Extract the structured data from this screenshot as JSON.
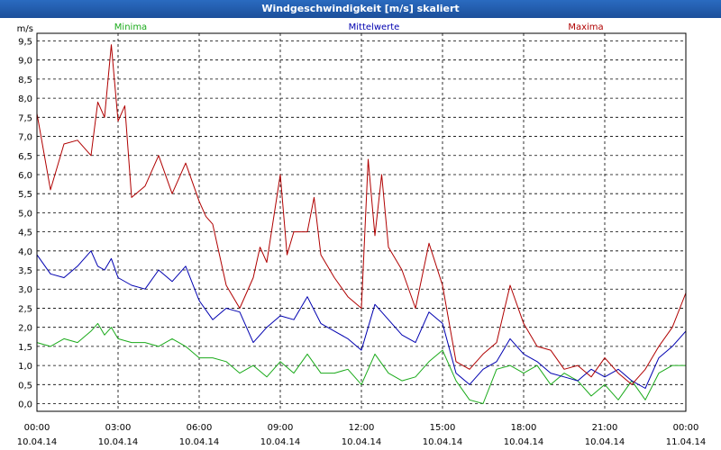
{
  "window": {
    "title": "Windgeschwindigkeit [m/s] skaliert"
  },
  "chart_data": {
    "type": "line",
    "title": "Windgeschwindigkeit [m/s] skaliert",
    "ylabel": "m/s",
    "ylim": [
      -0.2,
      9.7
    ],
    "yticks": [
      "9,5",
      "9,0",
      "8,5",
      "8,0",
      "7,5",
      "7,0",
      "6,5",
      "6,0",
      "5,5",
      "5,0",
      "4,5",
      "4,0",
      "3,5",
      "3,0",
      "2,5",
      "2,0",
      "1,5",
      "1,0",
      "0,5",
      "0,0"
    ],
    "ytick_values": [
      9.5,
      9.0,
      8.5,
      8.0,
      7.5,
      7.0,
      6.5,
      6.0,
      5.5,
      5.0,
      4.5,
      4.0,
      3.5,
      3.0,
      2.5,
      2.0,
      1.5,
      1.0,
      0.5,
      0.0
    ],
    "xlim": [
      0,
      24
    ],
    "xticks": [
      {
        "x": 0,
        "time": "00:00",
        "date": "10.04.14"
      },
      {
        "x": 3,
        "time": "03:00",
        "date": "10.04.14"
      },
      {
        "x": 6,
        "time": "06:00",
        "date": "10.04.14"
      },
      {
        "x": 9,
        "time": "09:00",
        "date": "10.04.14"
      },
      {
        "x": 12,
        "time": "12:00",
        "date": "10.04.14"
      },
      {
        "x": 15,
        "time": "15:00",
        "date": "10.04.14"
      },
      {
        "x": 18,
        "time": "18:00",
        "date": "10.04.14"
      },
      {
        "x": 21,
        "time": "21:00",
        "date": "10.04.14"
      },
      {
        "x": 24,
        "time": "00:00",
        "date": "11.04.14"
      }
    ],
    "grid": true,
    "legend_position": "top",
    "series": [
      {
        "name": "Minima",
        "color": "#1aaa1a",
        "x": [
          0,
          0.5,
          1,
          1.5,
          2,
          2.25,
          2.5,
          2.75,
          3,
          3.5,
          4,
          4.5,
          5,
          5.5,
          6,
          6.5,
          7,
          7.5,
          8,
          8.5,
          9,
          9.5,
          10,
          10.5,
          11,
          11.5,
          12,
          12.5,
          13,
          13.5,
          14,
          14.5,
          15,
          15.5,
          16,
          16.5,
          17,
          17.5,
          18,
          18.5,
          19,
          19.5,
          20,
          20.5,
          21,
          21.5,
          22,
          22.5,
          23,
          23.5,
          24
        ],
        "values": [
          1.6,
          1.5,
          1.7,
          1.6,
          1.9,
          2.1,
          1.8,
          2.0,
          1.7,
          1.6,
          1.6,
          1.5,
          1.7,
          1.5,
          1.2,
          1.2,
          1.1,
          0.8,
          1.0,
          0.7,
          1.1,
          0.8,
          1.3,
          0.8,
          0.8,
          0.9,
          0.5,
          1.3,
          0.8,
          0.6,
          0.7,
          1.1,
          1.4,
          0.6,
          0.1,
          0.0,
          0.9,
          1.0,
          0.8,
          1.0,
          0.5,
          0.8,
          0.6,
          0.2,
          0.5,
          0.1,
          0.6,
          0.1,
          0.8,
          1.0,
          1.0
        ]
      },
      {
        "name": "Mittelwerte",
        "color": "#0000b0",
        "x": [
          0,
          0.5,
          1,
          1.5,
          2,
          2.25,
          2.5,
          2.75,
          3,
          3.5,
          4,
          4.5,
          5,
          5.5,
          6,
          6.5,
          7,
          7.5,
          8,
          8.5,
          9,
          9.5,
          10,
          10.5,
          11,
          11.5,
          12,
          12.5,
          13,
          13.5,
          14,
          14.5,
          15,
          15.5,
          16,
          16.5,
          17,
          17.5,
          18,
          18.5,
          19,
          19.5,
          20,
          20.5,
          21,
          21.5,
          22,
          22.5,
          23,
          23.5,
          24
        ],
        "values": [
          3.9,
          3.4,
          3.3,
          3.6,
          4.0,
          3.6,
          3.5,
          3.8,
          3.3,
          3.1,
          3.0,
          3.5,
          3.2,
          3.6,
          2.7,
          2.2,
          2.5,
          2.4,
          1.6,
          2.0,
          2.3,
          2.2,
          2.8,
          2.1,
          1.9,
          1.7,
          1.4,
          2.6,
          2.2,
          1.8,
          1.6,
          2.4,
          2.1,
          0.8,
          0.5,
          0.9,
          1.1,
          1.7,
          1.3,
          1.1,
          0.8,
          0.7,
          0.6,
          0.9,
          0.7,
          0.9,
          0.6,
          0.4,
          1.2,
          1.5,
          1.9
        ]
      },
      {
        "name": "Maxima",
        "color": "#b00000",
        "x": [
          0,
          0.25,
          0.5,
          1,
          1.5,
          2,
          2.25,
          2.5,
          2.75,
          3,
          3.25,
          3.5,
          4,
          4.5,
          5,
          5.5,
          6,
          6.25,
          6.5,
          7,
          7.5,
          8,
          8.25,
          8.5,
          9,
          9.25,
          9.5,
          10,
          10.25,
          10.5,
          11,
          11.5,
          12,
          12.25,
          12.5,
          12.75,
          13,
          13.5,
          14,
          14.5,
          15,
          15.5,
          16,
          16.5,
          17,
          17.5,
          18,
          18.5,
          19,
          19.5,
          20,
          20.5,
          21,
          21.5,
          22,
          22.5,
          23,
          23.5,
          24
        ],
        "values": [
          7.6,
          6.6,
          5.6,
          6.8,
          6.9,
          6.5,
          7.9,
          7.5,
          9.4,
          7.4,
          7.8,
          5.4,
          5.7,
          6.5,
          5.5,
          6.3,
          5.3,
          4.9,
          4.7,
          3.1,
          2.5,
          3.3,
          4.1,
          3.7,
          6.0,
          3.9,
          4.5,
          4.5,
          5.4,
          3.9,
          3.3,
          2.8,
          2.5,
          6.4,
          4.4,
          6.0,
          4.1,
          3.5,
          2.5,
          4.2,
          3.1,
          1.1,
          0.9,
          1.3,
          1.6,
          3.1,
          2.1,
          1.5,
          1.4,
          0.9,
          1.0,
          0.7,
          1.2,
          0.8,
          0.5,
          0.9,
          1.5,
          2.0,
          2.9
        ]
      }
    ]
  }
}
